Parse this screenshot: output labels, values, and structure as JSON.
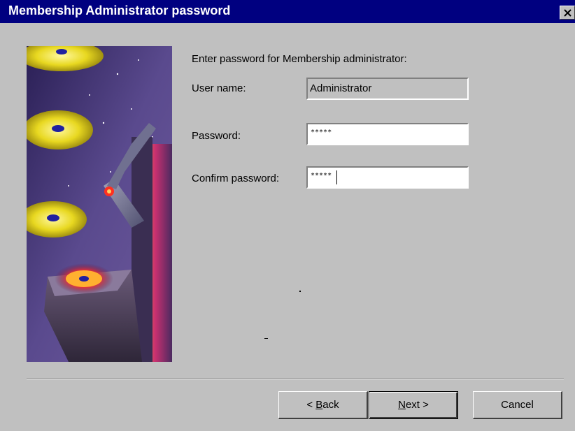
{
  "window": {
    "title": "Membership Administrator password",
    "colors": {
      "titlebar": "#000080",
      "face": "#c0c0c0"
    }
  },
  "form": {
    "instruction": "Enter password for Membership administrator:",
    "username_label": "User name:",
    "username_value": "Administrator",
    "password_label": "Password:",
    "password_value": "*****",
    "confirm_label": "Confirm password:",
    "confirm_value": "*****"
  },
  "buttons": {
    "back_prefix": "< ",
    "back_mnemonic": "B",
    "back_rest": "ack",
    "next_mnemonic": "N",
    "next_rest": "ext >",
    "cancel": "Cancel"
  },
  "icons": {
    "close": "close-icon",
    "art": "wizard-illustration-cds"
  }
}
